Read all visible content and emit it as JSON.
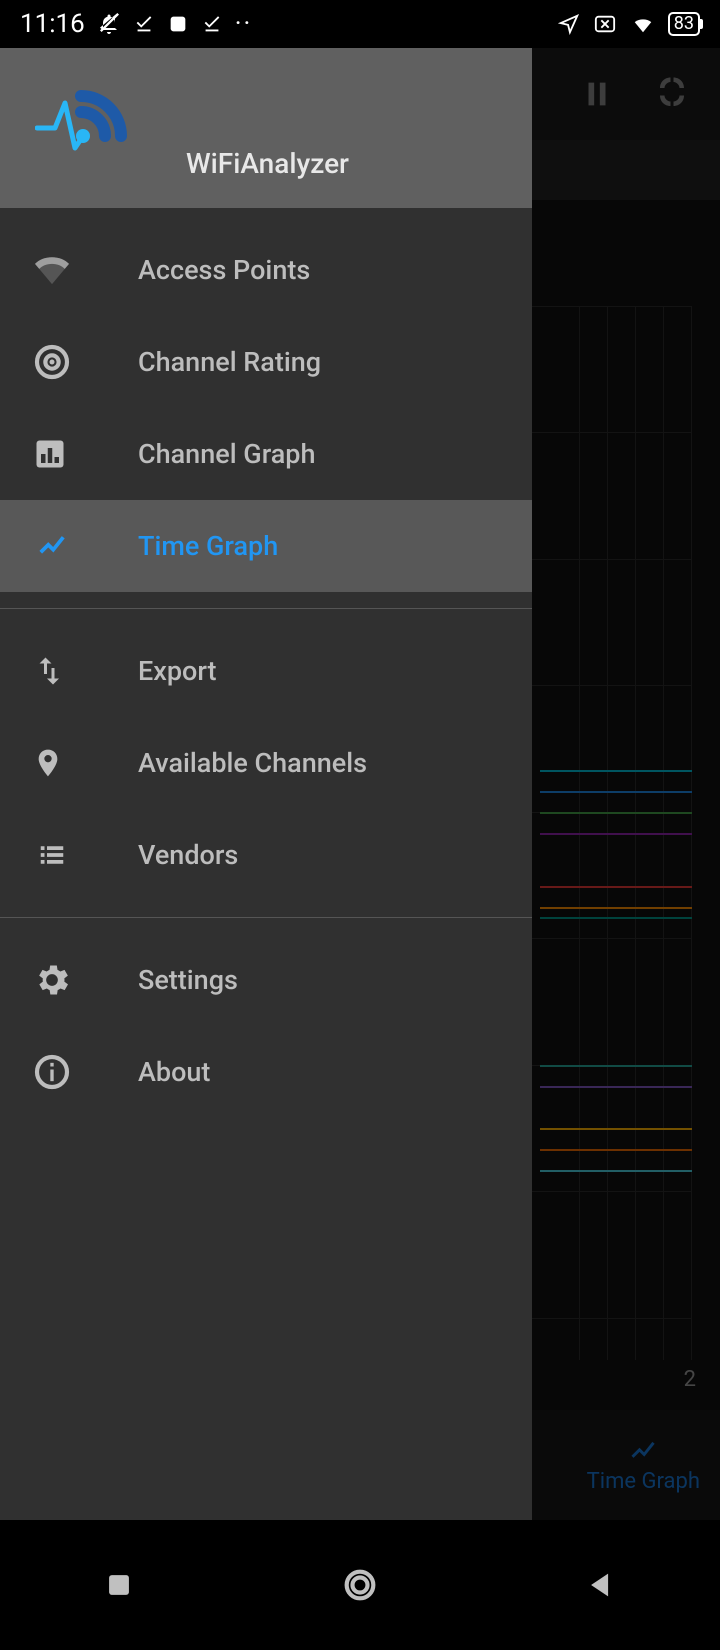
{
  "status": {
    "time": "11:16",
    "battery": "83"
  },
  "app_title": "WiFiAnalyzer",
  "drawer": {
    "items": [
      {
        "label": "Access Points"
      },
      {
        "label": "Channel Rating"
      },
      {
        "label": "Channel Graph"
      },
      {
        "label": "Time Graph"
      },
      {
        "label": "Export"
      },
      {
        "label": "Available Channels"
      },
      {
        "label": "Vendors"
      },
      {
        "label": "Settings"
      },
      {
        "label": "About"
      }
    ],
    "selected_index": 3
  },
  "bottom_nav": {
    "time_graph": "Time Graph"
  },
  "chart_data": {
    "type": "line",
    "title": "",
    "xlabel": "",
    "ylabel": "",
    "x_tick_visible": "2",
    "note": "Only right-edge portion of the time-graph is visible behind the drawer; values are signal-strength bars at the current time slice.",
    "series_visible_edge": [
      {
        "name": "cyan-1",
        "color": "#00bcd4",
        "y_frac": 0.44
      },
      {
        "name": "blue-1",
        "color": "#1e88e5",
        "y_frac": 0.46
      },
      {
        "name": "green-1",
        "color": "#43a047",
        "y_frac": 0.48
      },
      {
        "name": "purple-1",
        "color": "#8e24aa",
        "y_frac": 0.5
      },
      {
        "name": "red-1",
        "color": "#e53935",
        "y_frac": 0.55
      },
      {
        "name": "orange-1",
        "color": "#fb8c00",
        "y_frac": 0.57
      },
      {
        "name": "teal-2",
        "color": "#009688",
        "y_frac": 0.58
      },
      {
        "name": "teal-3",
        "color": "#26a69a",
        "y_frac": 0.72
      },
      {
        "name": "purple-2",
        "color": "#7e57c2",
        "y_frac": 0.74
      },
      {
        "name": "amber-1",
        "color": "#ffb300",
        "y_frac": 0.78
      },
      {
        "name": "orange-2",
        "color": "#ef6c00",
        "y_frac": 0.8
      },
      {
        "name": "cyan-2",
        "color": "#4dd0e1",
        "y_frac": 0.82
      }
    ]
  }
}
